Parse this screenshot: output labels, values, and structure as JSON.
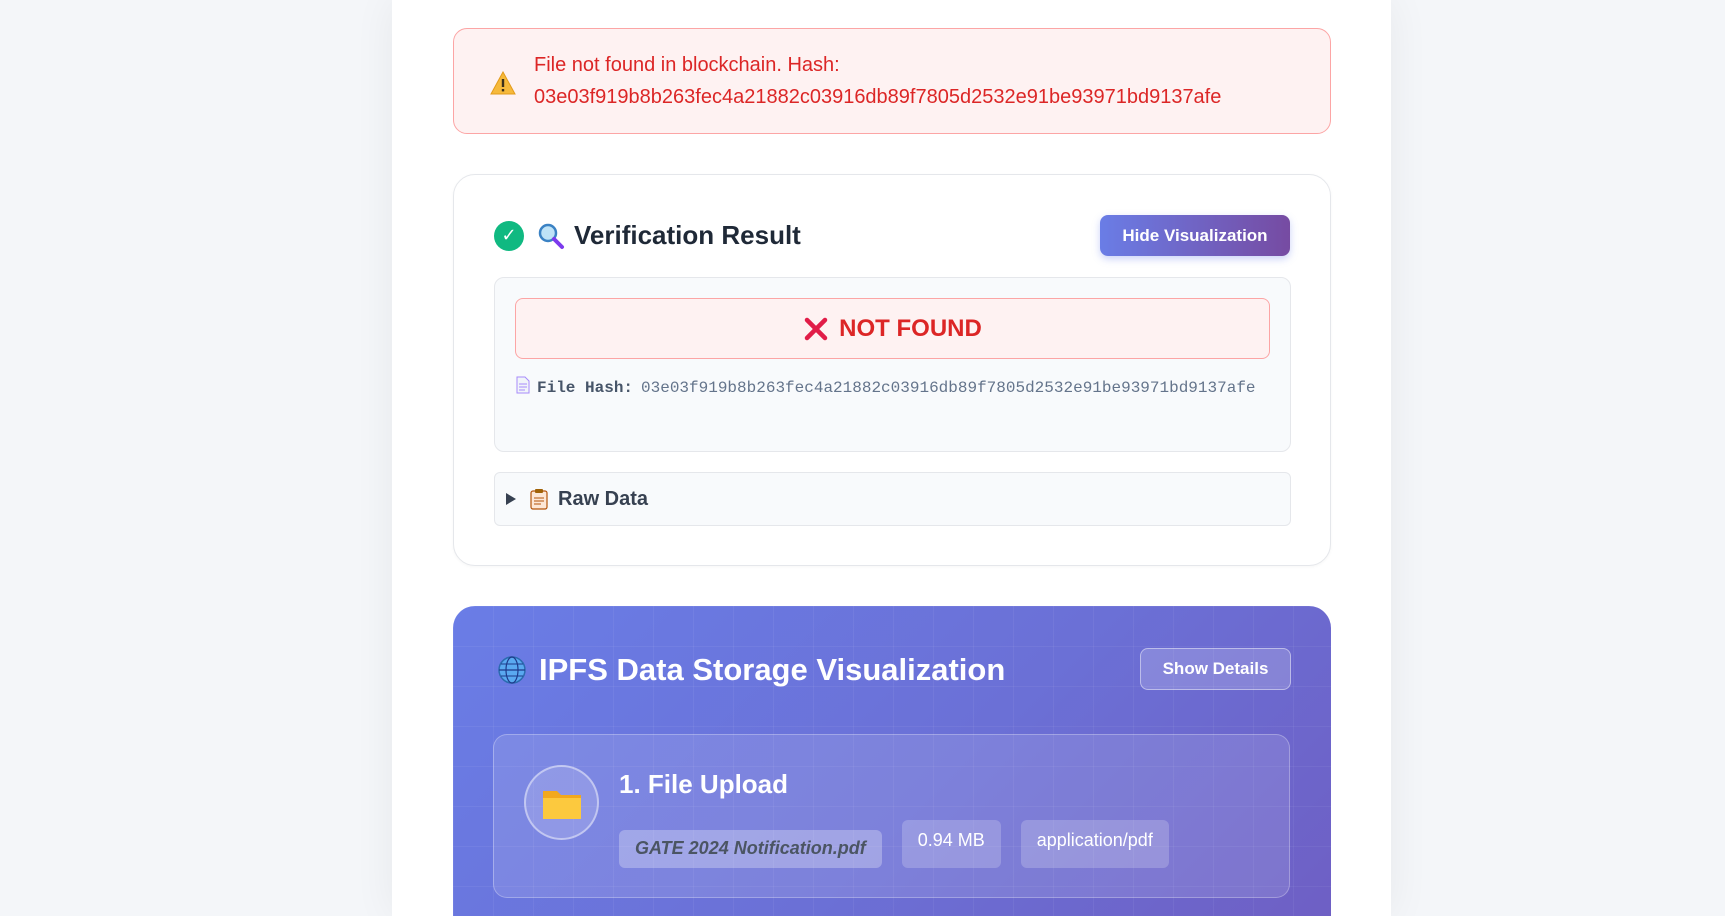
{
  "error_banner": {
    "icon": "warning-icon",
    "message": "File not found in blockchain. Hash:",
    "hash": "03e03f919b8b263fec4a21882c03916db89f7805d2532e91be93971bd9137afe"
  },
  "verification": {
    "title": "Verification Result",
    "icons": [
      "check-circle-icon",
      "magnifier-icon"
    ],
    "hide_button_label": "Hide Visualization",
    "status": "NOT FOUND",
    "file_hash_label": "File Hash:",
    "file_hash_value": "03e03f919b8b263fec4a21882c03916db89f7805d2532e91be93971bd9137afe",
    "raw_data_label": "Raw Data"
  },
  "ipfs": {
    "title": "IPFS Data Storage Visualization",
    "show_details_label": "Show Details",
    "step": {
      "title": "1. File Upload",
      "file_name": "GATE 2024 Notification.pdf",
      "file_size": "0.94 MB",
      "mime_type": "application/pdf"
    }
  },
  "colors": {
    "error_red": "#dc2626",
    "success_green": "#10b981",
    "accent_start": "#6a7de6",
    "accent_end": "#764ba2"
  }
}
